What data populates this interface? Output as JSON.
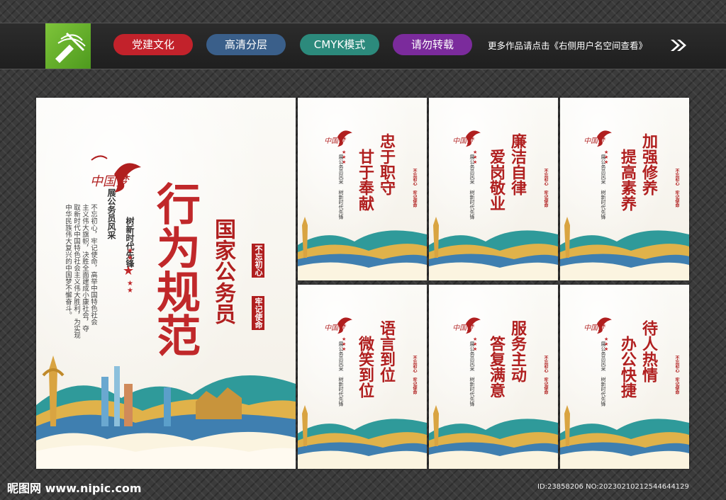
{
  "header": {
    "logo_icon": "pen-nib-icon",
    "tags": [
      {
        "label": "党建文化",
        "color": "#c2222b"
      },
      {
        "label": "高清分层",
        "color": "#3a5f8a"
      },
      {
        "label": "CMYK模式",
        "color": "#2c8a7c"
      },
      {
        "label": "请勿转载",
        "color": "#7b2b9c"
      }
    ],
    "tagline": "更多作品请点击《右侧用户名空间查看》",
    "arrow_icon": "double-chevron-right-icon"
  },
  "main_poster": {
    "logo_text": "中国梦",
    "title": "行为规范",
    "subtitle": "国家公务员",
    "slogan_1": "展公务员风采",
    "slogan_2": "树新时代先锋",
    "stamp_1": "不忘初心",
    "stamp_2": "牢记使命",
    "body": [
      "不忘初心，牢记使命，高举中国特色社会",
      "主义伟大旗帜，决胜全面建成小康社会，夺",
      "取新时代中国特色社会主义伟大胜利，为实现",
      "中华民族伟大复兴的中国梦不懈奋斗。"
    ]
  },
  "small_posters": [
    {
      "line1": "忠于职守",
      "line2": "甘于奉献"
    },
    {
      "line1": "廉洁自律",
      "line2": "爱岗敬业"
    },
    {
      "line1": "加强修养",
      "line2": "提高素养"
    },
    {
      "line1": "语言到位",
      "line2": "微笑到位"
    },
    {
      "line1": "服务主动",
      "line2": "答复满意"
    },
    {
      "line1": "待人热情",
      "line2": "办公快捷"
    }
  ],
  "small_common": {
    "logo_text": "中国梦",
    "slogan_1": "展公务员风采",
    "slogan_2": "树新时代先锋",
    "stamp": "不忘初心  牢记使命"
  },
  "footer": {
    "watermark": "昵图网 www.nipic.com",
    "id_line": "ID:23858206 NO:20230210212544644129"
  },
  "colors": {
    "accent_red": "#b01f1f",
    "gold": "#d9a441",
    "teal": "#2f9a9a"
  }
}
